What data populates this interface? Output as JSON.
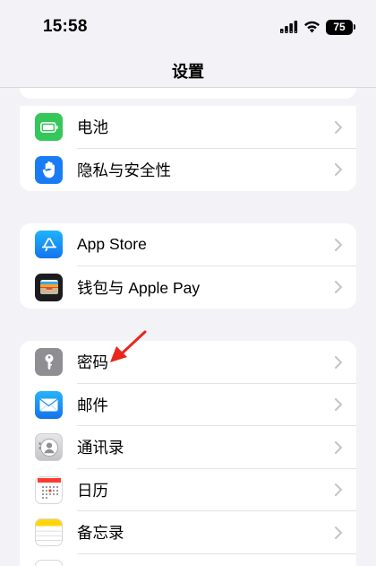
{
  "status_bar": {
    "time": "15:58",
    "battery": "75"
  },
  "nav": {
    "title": "设置"
  },
  "groups": [
    {
      "items": [
        {
          "label": "电池",
          "icon": "battery-icon",
          "color": "#34c759"
        },
        {
          "label": "隐私与安全性",
          "icon": "hand-icon",
          "color": "#1a7cf5"
        }
      ]
    },
    {
      "items": [
        {
          "label": "App Store",
          "icon": "app-store-icon",
          "color": "#1a8af5"
        },
        {
          "label": "钱包与 Apple Pay",
          "icon": "wallet-icon",
          "color": "#1c1c1e"
        }
      ]
    },
    {
      "items": [
        {
          "label": "密码",
          "icon": "key-icon",
          "color": "#8e8e93"
        },
        {
          "label": "邮件",
          "icon": "mail-icon",
          "color": "#1a8af5"
        },
        {
          "label": "通讯录",
          "icon": "contacts-icon",
          "color": "#c7c7cc"
        },
        {
          "label": "日历",
          "icon": "calendar-icon",
          "color": "#ffffff"
        },
        {
          "label": "备忘录",
          "icon": "notes-icon",
          "color": "#ffd60a"
        }
      ]
    }
  ],
  "annotation": {
    "arrow_color": "#e8261c"
  }
}
